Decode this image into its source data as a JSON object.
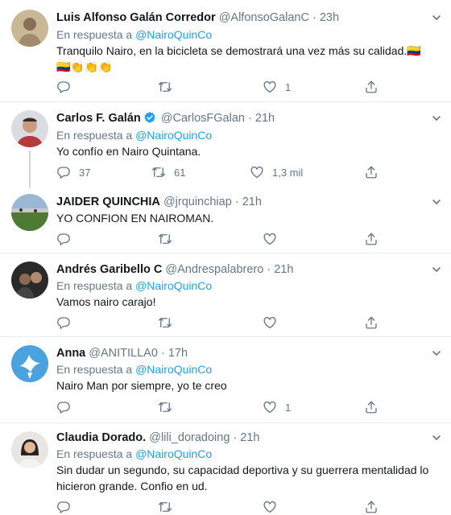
{
  "reply_prefix": "En respuesta a",
  "tweets": [
    {
      "name": "Luis Alfonso Galán Corredor",
      "handle": "@AlfonsoGalanC",
      "time": "23h",
      "reply_to": "@NairoQuinCo",
      "text": "Tranquilo Nairo, en la bicicleta se demostrará una vez más su calidad.",
      "emoji_flag": "🇨🇴",
      "emoji_line2": "🇨🇴👏👏👏",
      "replies": "",
      "retweets": "",
      "likes": "1",
      "verified": false
    },
    {
      "name": "Carlos F. Galán",
      "handle": "@CarlosFGalan",
      "time": "21h",
      "reply_to": "@NairoQuinCo",
      "text": "Yo confío en Nairo Quintana.",
      "replies": "37",
      "retweets": "61",
      "likes": "1,3 mil",
      "verified": true
    },
    {
      "name": "JAIDER QUINCHIA",
      "handle": "@jrquinchiap",
      "time": "21h",
      "text": "YO CONFION EN NAIROMAN.",
      "replies": "",
      "retweets": "",
      "likes": "",
      "verified": false
    },
    {
      "name": "Andrés Garibello C",
      "handle": "@Andrespalabrero",
      "time": "21h",
      "reply_to": "@NairoQuinCo",
      "text": "Vamos nairo carajo!",
      "replies": "",
      "retweets": "",
      "likes": "",
      "verified": false
    },
    {
      "name": "Anna",
      "handle": "@ANITILLA0",
      "time": "17h",
      "reply_to": "@NairoQuinCo",
      "text": "Nairo Man por siempre, yo te creo",
      "replies": "",
      "retweets": "",
      "likes": "1",
      "verified": false
    },
    {
      "name": "Claudia Dorado.",
      "handle": "@lili_doradoing",
      "time": "21h",
      "reply_to": "@NairoQuinCo",
      "text": "Sin dudar un segundo, su capacidad deportiva y su guerrera mentalidad lo hicieron grande. Confio en ud.",
      "replies": "",
      "retweets": "",
      "likes": "",
      "verified": false
    }
  ],
  "separator": "·",
  "colors": {
    "link": "#1da1f2",
    "muted": "#657786",
    "text": "#14171a",
    "border": "#e6ecf0"
  }
}
